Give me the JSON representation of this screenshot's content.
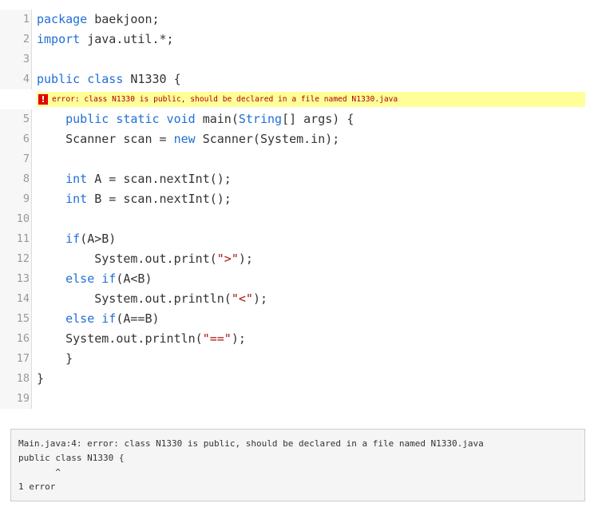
{
  "editor": {
    "line_numbers": [
      "1",
      "2",
      "3",
      "4",
      "5",
      "6",
      "7",
      "8",
      "9",
      "10",
      "11",
      "12",
      "13",
      "14",
      "15",
      "16",
      "17",
      "18",
      "19"
    ],
    "lines": [
      [
        {
          "t": "package",
          "k": "kw"
        },
        {
          "t": " baekjoon;"
        }
      ],
      [
        {
          "t": "import",
          "k": "kw"
        },
        {
          "t": " java.util.*;"
        }
      ],
      [],
      [
        {
          "t": "public class",
          "k": "kw"
        },
        {
          "t": " N1330 {"
        }
      ],
      [
        {
          "t": "    "
        },
        {
          "t": "public static void",
          "k": "kw"
        },
        {
          "t": " main("
        },
        {
          "t": "String",
          "k": "kw"
        },
        {
          "t": "[] args) {"
        }
      ],
      [
        {
          "t": "    Scanner scan = "
        },
        {
          "t": "new",
          "k": "kw"
        },
        {
          "t": " Scanner(System.in);"
        }
      ],
      [],
      [
        {
          "t": "    "
        },
        {
          "t": "int",
          "k": "kw"
        },
        {
          "t": " A = scan.nextInt();"
        }
      ],
      [
        {
          "t": "    "
        },
        {
          "t": "int",
          "k": "kw"
        },
        {
          "t": " B = scan.nextInt();"
        }
      ],
      [],
      [
        {
          "t": "    "
        },
        {
          "t": "if",
          "k": "kw"
        },
        {
          "t": "(A>B)"
        }
      ],
      [
        {
          "t": "        System.out.print("
        },
        {
          "t": "\">\"",
          "k": "str"
        },
        {
          "t": ");"
        }
      ],
      [
        {
          "t": "    "
        },
        {
          "t": "else if",
          "k": "kw"
        },
        {
          "t": "(A<B)"
        }
      ],
      [
        {
          "t": "        System.out.println("
        },
        {
          "t": "\"<\"",
          "k": "str"
        },
        {
          "t": ");"
        }
      ],
      [
        {
          "t": "    "
        },
        {
          "t": "else if",
          "k": "kw"
        },
        {
          "t": "(A==B)"
        }
      ],
      [
        {
          "t": "    System.out.println("
        },
        {
          "t": "\"==\"",
          "k": "str"
        },
        {
          "t": ");"
        }
      ],
      [
        {
          "t": "    }"
        }
      ],
      [
        {
          "t": "}"
        }
      ],
      []
    ],
    "error_after_line": 4,
    "error_icon": "!",
    "error_message": "error: class N1330 is public, should be declared in a file named N1330.java"
  },
  "console": {
    "lines": [
      "Main.java:4: error: class N1330 is public, should be declared in a file named N1330.java",
      "public class N1330 {",
      "       ^",
      "1 error"
    ]
  },
  "colors": {
    "keyword": "#1f6fd6",
    "string": "#aa1111",
    "error_highlight": "#ffff99",
    "error_icon_bg": "#e30000"
  },
  "icons": {
    "error": "error-icon"
  }
}
